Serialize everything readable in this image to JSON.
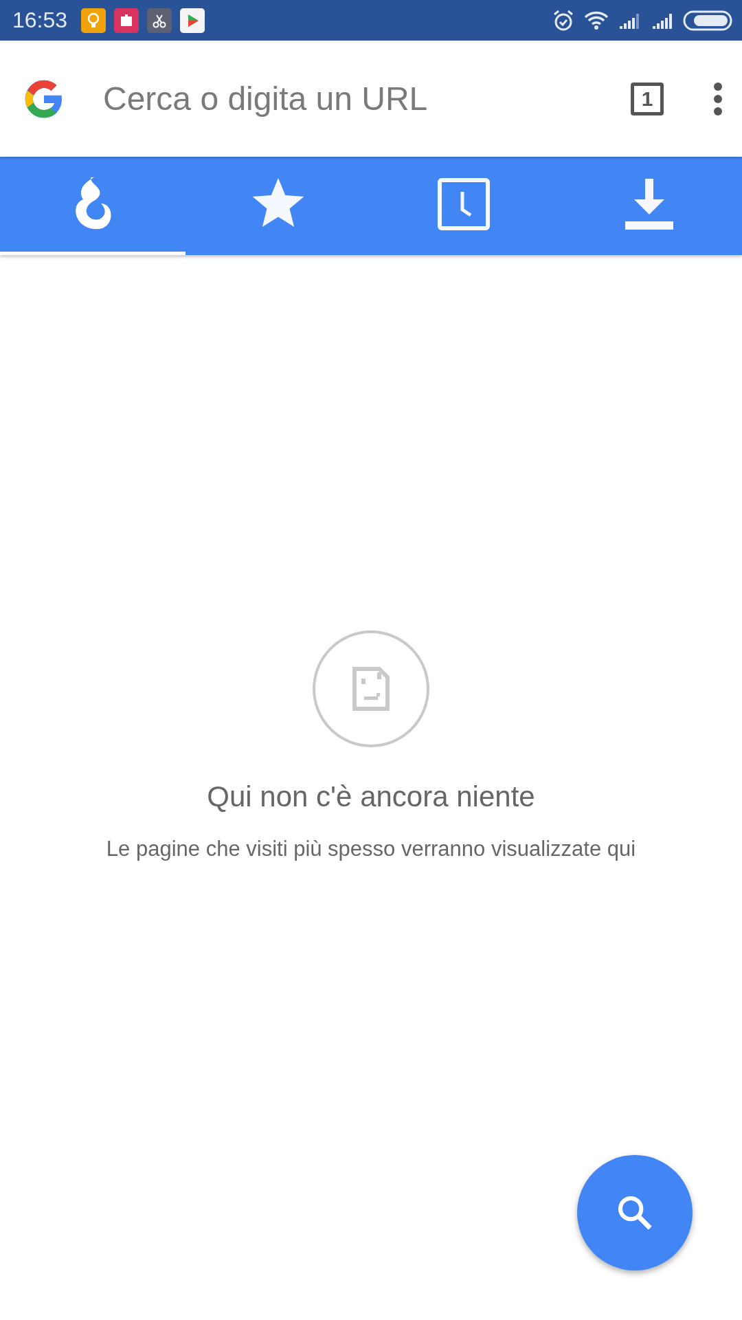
{
  "status_bar": {
    "time": "16:53"
  },
  "toolbar": {
    "placeholder": "Cerca o digita un URL",
    "tab_count": "1"
  },
  "tabs": [
    {
      "kind": "popular",
      "selected": true
    },
    {
      "kind": "bookmarks",
      "selected": false
    },
    {
      "kind": "history",
      "selected": false
    },
    {
      "kind": "downloads",
      "selected": false
    }
  ],
  "empty_state": {
    "title": "Qui non c'è ancora niente",
    "message": "Le pagine che visiti più spesso verranno visualizzate qui"
  }
}
